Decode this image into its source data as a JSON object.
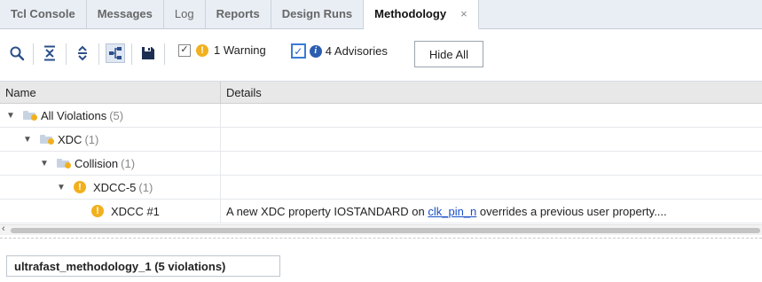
{
  "tabs": [
    {
      "label": "Tcl Console"
    },
    {
      "label": "Messages"
    },
    {
      "label": "Log"
    },
    {
      "label": "Reports"
    },
    {
      "label": "Design Runs"
    },
    {
      "label": "Methodology"
    }
  ],
  "active_tab_close": "×",
  "toolbar": {
    "icons": [
      "search-icon",
      "collapse-all-icon",
      "expand-all-icon",
      "group-by-icon",
      "save-icon"
    ],
    "warning_filter": {
      "label": "1 Warning",
      "checked": true
    },
    "advisory_filter": {
      "label": "4 Advisories",
      "checked": true
    },
    "hide_all_label": "Hide All"
  },
  "columns": {
    "name": "Name",
    "details": "Details"
  },
  "tree": {
    "all": {
      "label": "All Violations",
      "count": "(5)"
    },
    "xdc": {
      "label": "XDC",
      "count": "(1)"
    },
    "collision": {
      "label": "Collision",
      "count": "(1)"
    },
    "xdcc5": {
      "label": "XDCC-5",
      "count": "(1)"
    },
    "leaf": {
      "label": "XDCC #1",
      "details_prefix": "A new XDC property IOSTANDARD on ",
      "details_link": "clk_pin_n",
      "details_suffix": " overrides a previous user property...."
    }
  },
  "bottom_tab": "ultrafast_methodology_1 (5 violations)",
  "colors": {
    "warning": "#f2b01e",
    "info": "#2a5db0",
    "link": "#1a4fc7"
  }
}
